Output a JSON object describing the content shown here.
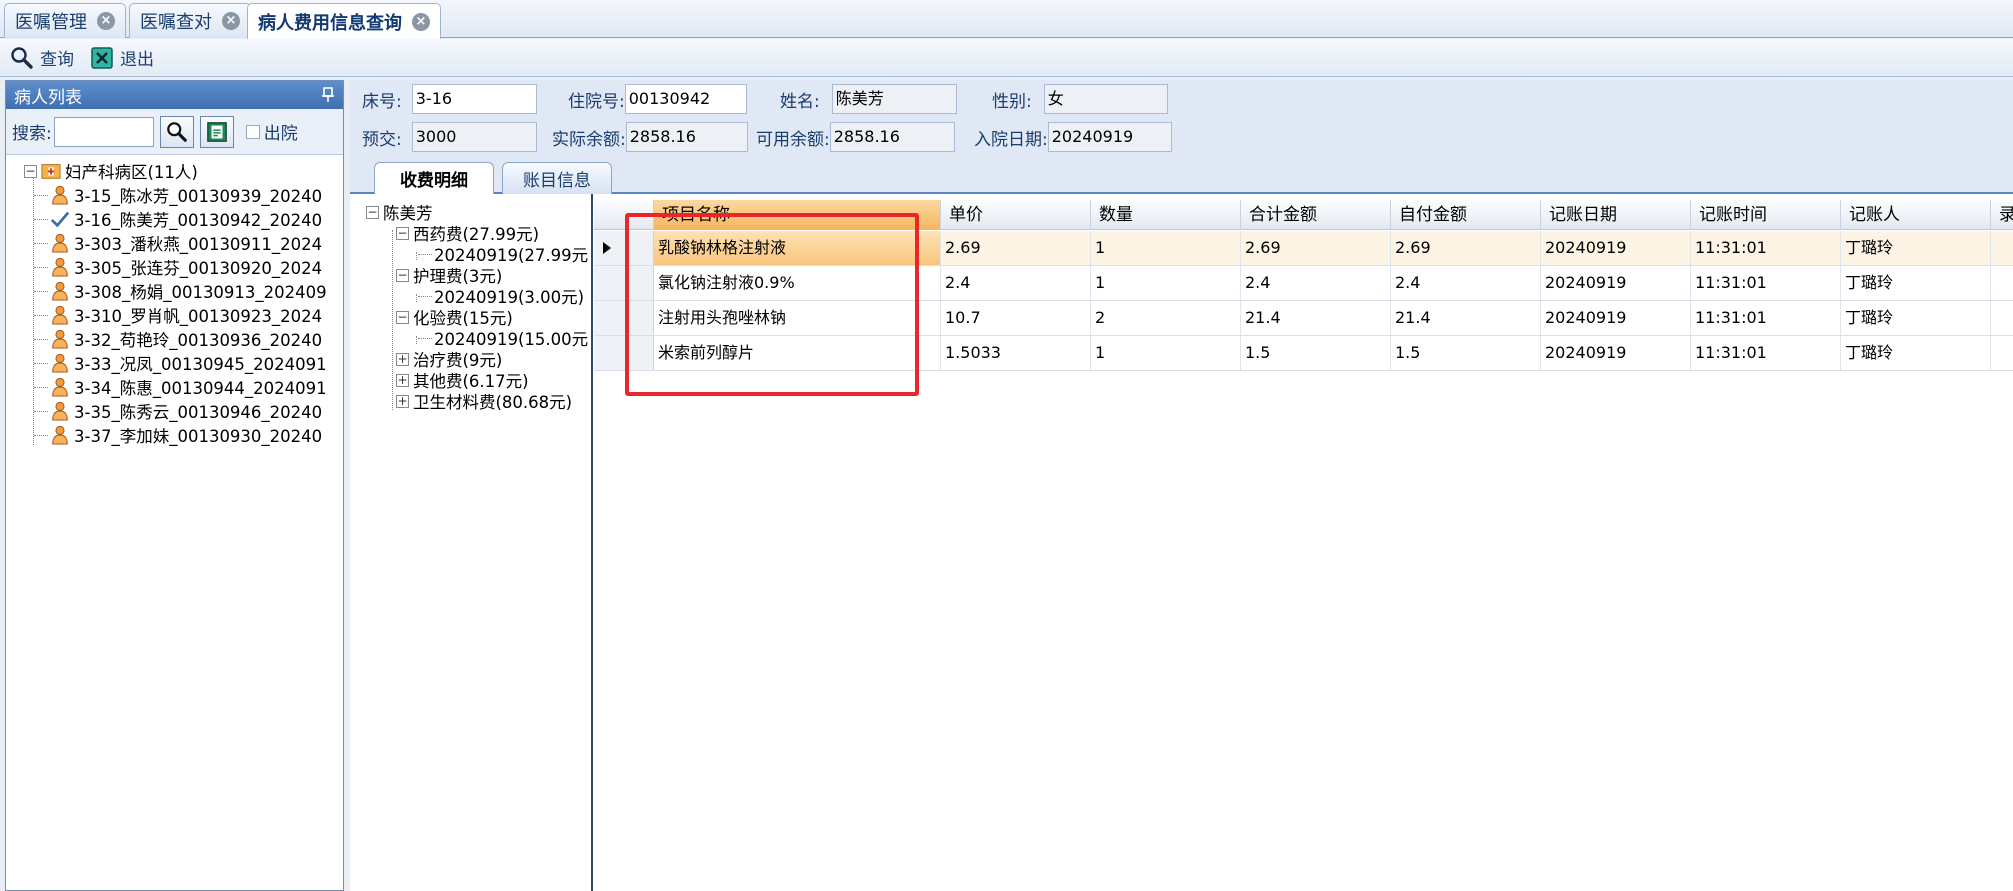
{
  "tabs": [
    {
      "label": "医嘱管理",
      "active": false
    },
    {
      "label": "医嘱查对",
      "active": false
    },
    {
      "label": "病人费用信息查询",
      "active": true
    }
  ],
  "toolbar": {
    "query_label": "查询",
    "exit_label": "退出"
  },
  "left_panel": {
    "title": "病人列表",
    "pin_glyph": "ꟷ",
    "search_label": "搜索:",
    "search_value": "",
    "discharged_label": "出院",
    "ward_label": "妇产科病区(11人)",
    "patients": [
      {
        "label": "3-15_陈冰芳_00130939_20240",
        "icon": "patient-icon"
      },
      {
        "label": "3-16_陈美芳_00130942_20240",
        "icon": "check-icon",
        "selected": true
      },
      {
        "label": "3-303_潘秋燕_00130911_2024",
        "icon": "patient-icon"
      },
      {
        "label": "3-305_张连芬_00130920_2024",
        "icon": "patient-icon"
      },
      {
        "label": "3-308_杨娟_00130913_202409",
        "icon": "patient-icon"
      },
      {
        "label": "3-310_罗肖帆_00130923_2024",
        "icon": "patient-icon"
      },
      {
        "label": "3-32_苟艳玲_00130936_20240",
        "icon": "patient-icon"
      },
      {
        "label": "3-33_况凤_00130945_2024091",
        "icon": "patient-icon"
      },
      {
        "label": "3-34_陈惠_00130944_2024091",
        "icon": "patient-icon"
      },
      {
        "label": "3-35_陈秀云_00130946_20240",
        "icon": "patient-icon"
      },
      {
        "label": "3-37_李加妹_00130930_20240",
        "icon": "patient-icon"
      }
    ]
  },
  "patient_info": {
    "bed_label": "床号:",
    "bed_value": "3-16",
    "admission_no_label": "住院号:",
    "admission_no_value": "00130942",
    "name_label": "姓名:",
    "name_value": "陈美芳",
    "gender_label": "性别:",
    "gender_value": "女",
    "prepay_label": "预交:",
    "prepay_value": "3000",
    "actual_balance_label": "实际余额:",
    "actual_balance_value": "2858.16",
    "available_balance_label": "可用余额:",
    "available_balance_value": "2858.16",
    "admit_date_label": "入院日期:",
    "admit_date_value": "20240919"
  },
  "sub_tabs": [
    {
      "label": "收费明细",
      "active": true
    },
    {
      "label": "账目信息",
      "active": false
    }
  ],
  "category_tree": {
    "root": "陈美芳",
    "items": [
      {
        "label": "西药费(27.99元)",
        "expanded": true,
        "children": [
          "20240919(27.99元"
        ]
      },
      {
        "label": "护理费(3元)",
        "expanded": true,
        "children": [
          "20240919(3.00元)"
        ]
      },
      {
        "label": "化验费(15元)",
        "expanded": true,
        "children": [
          "20240919(15.00元"
        ]
      },
      {
        "label": "治疗费(9元)",
        "expanded": false,
        "children": []
      },
      {
        "label": "其他费(6.17元)",
        "expanded": false,
        "children": []
      },
      {
        "label": "卫生材料费(80.68元)",
        "expanded": false,
        "children": []
      }
    ]
  },
  "grid": {
    "columns": [
      "项目名称",
      "单价",
      "数量",
      "合计金额",
      "自付金额",
      "记账日期",
      "记账时间",
      "记账人",
      "录"
    ],
    "rows": [
      [
        "乳酸钠林格注射液",
        "2.69",
        "1",
        "2.69",
        "2.69",
        "20240919",
        "11:31:01",
        "丁璐玲",
        ""
      ],
      [
        "氯化钠注射液0.9%",
        "2.4",
        "1",
        "2.4",
        "2.4",
        "20240919",
        "11:31:01",
        "丁璐玲",
        ""
      ],
      [
        "注射用头孢唑林钠",
        "10.7",
        "2",
        "21.4",
        "21.4",
        "20240919",
        "11:31:01",
        "丁璐玲",
        ""
      ],
      [
        "米索前列醇片",
        "1.5033",
        "1",
        "1.5",
        "1.5",
        "20240919",
        "11:31:01",
        "丁璐玲",
        ""
      ]
    ],
    "selected_row": 0
  },
  "colors": {
    "accent": "#3f6fb0",
    "highlight": "#f6b45e",
    "annotation": "#e8262b"
  }
}
